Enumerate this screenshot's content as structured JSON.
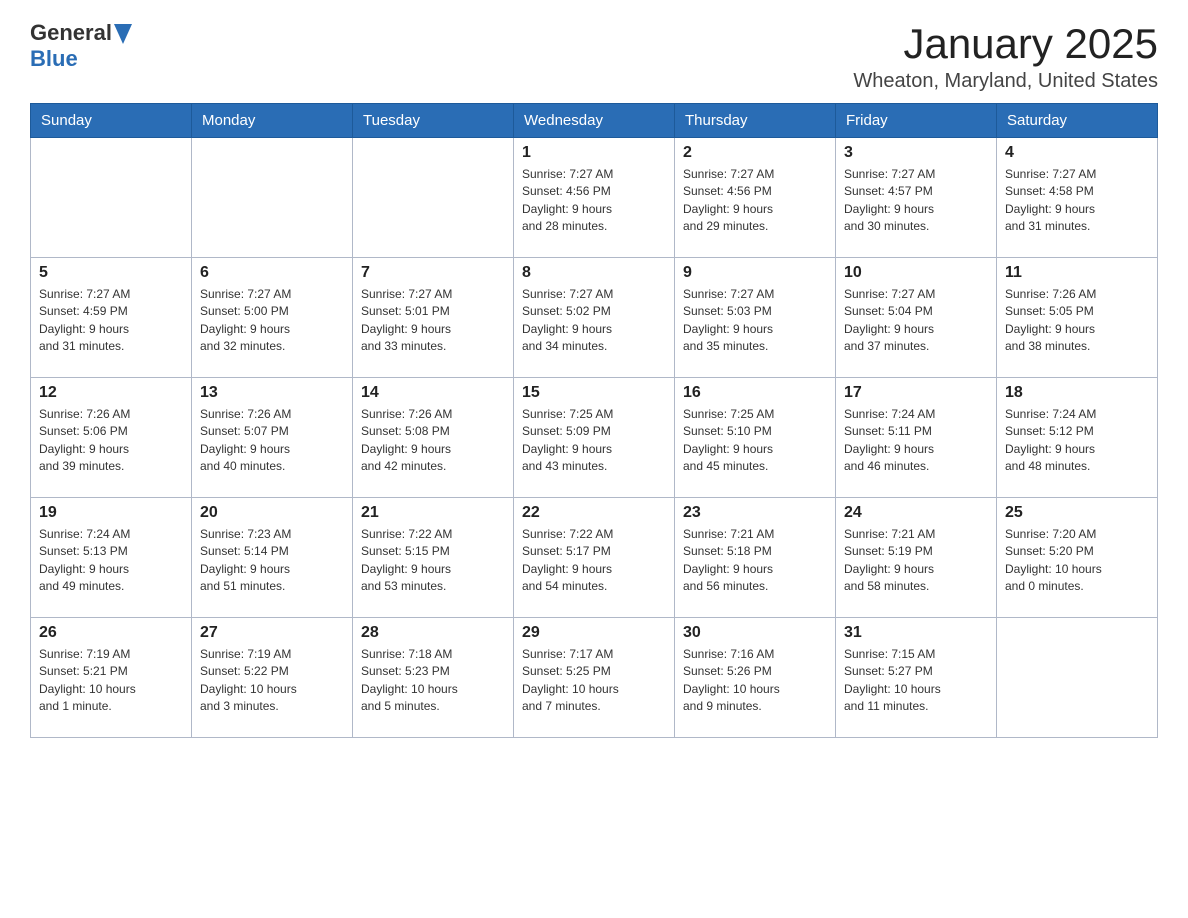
{
  "header": {
    "logo_general": "General",
    "logo_blue": "Blue",
    "month": "January 2025",
    "location": "Wheaton, Maryland, United States"
  },
  "weekdays": [
    "Sunday",
    "Monday",
    "Tuesday",
    "Wednesday",
    "Thursday",
    "Friday",
    "Saturday"
  ],
  "weeks": [
    [
      {
        "day": "",
        "info": ""
      },
      {
        "day": "",
        "info": ""
      },
      {
        "day": "",
        "info": ""
      },
      {
        "day": "1",
        "info": "Sunrise: 7:27 AM\nSunset: 4:56 PM\nDaylight: 9 hours\nand 28 minutes."
      },
      {
        "day": "2",
        "info": "Sunrise: 7:27 AM\nSunset: 4:56 PM\nDaylight: 9 hours\nand 29 minutes."
      },
      {
        "day": "3",
        "info": "Sunrise: 7:27 AM\nSunset: 4:57 PM\nDaylight: 9 hours\nand 30 minutes."
      },
      {
        "day": "4",
        "info": "Sunrise: 7:27 AM\nSunset: 4:58 PM\nDaylight: 9 hours\nand 31 minutes."
      }
    ],
    [
      {
        "day": "5",
        "info": "Sunrise: 7:27 AM\nSunset: 4:59 PM\nDaylight: 9 hours\nand 31 minutes."
      },
      {
        "day": "6",
        "info": "Sunrise: 7:27 AM\nSunset: 5:00 PM\nDaylight: 9 hours\nand 32 minutes."
      },
      {
        "day": "7",
        "info": "Sunrise: 7:27 AM\nSunset: 5:01 PM\nDaylight: 9 hours\nand 33 minutes."
      },
      {
        "day": "8",
        "info": "Sunrise: 7:27 AM\nSunset: 5:02 PM\nDaylight: 9 hours\nand 34 minutes."
      },
      {
        "day": "9",
        "info": "Sunrise: 7:27 AM\nSunset: 5:03 PM\nDaylight: 9 hours\nand 35 minutes."
      },
      {
        "day": "10",
        "info": "Sunrise: 7:27 AM\nSunset: 5:04 PM\nDaylight: 9 hours\nand 37 minutes."
      },
      {
        "day": "11",
        "info": "Sunrise: 7:26 AM\nSunset: 5:05 PM\nDaylight: 9 hours\nand 38 minutes."
      }
    ],
    [
      {
        "day": "12",
        "info": "Sunrise: 7:26 AM\nSunset: 5:06 PM\nDaylight: 9 hours\nand 39 minutes."
      },
      {
        "day": "13",
        "info": "Sunrise: 7:26 AM\nSunset: 5:07 PM\nDaylight: 9 hours\nand 40 minutes."
      },
      {
        "day": "14",
        "info": "Sunrise: 7:26 AM\nSunset: 5:08 PM\nDaylight: 9 hours\nand 42 minutes."
      },
      {
        "day": "15",
        "info": "Sunrise: 7:25 AM\nSunset: 5:09 PM\nDaylight: 9 hours\nand 43 minutes."
      },
      {
        "day": "16",
        "info": "Sunrise: 7:25 AM\nSunset: 5:10 PM\nDaylight: 9 hours\nand 45 minutes."
      },
      {
        "day": "17",
        "info": "Sunrise: 7:24 AM\nSunset: 5:11 PM\nDaylight: 9 hours\nand 46 minutes."
      },
      {
        "day": "18",
        "info": "Sunrise: 7:24 AM\nSunset: 5:12 PM\nDaylight: 9 hours\nand 48 minutes."
      }
    ],
    [
      {
        "day": "19",
        "info": "Sunrise: 7:24 AM\nSunset: 5:13 PM\nDaylight: 9 hours\nand 49 minutes."
      },
      {
        "day": "20",
        "info": "Sunrise: 7:23 AM\nSunset: 5:14 PM\nDaylight: 9 hours\nand 51 minutes."
      },
      {
        "day": "21",
        "info": "Sunrise: 7:22 AM\nSunset: 5:15 PM\nDaylight: 9 hours\nand 53 minutes."
      },
      {
        "day": "22",
        "info": "Sunrise: 7:22 AM\nSunset: 5:17 PM\nDaylight: 9 hours\nand 54 minutes."
      },
      {
        "day": "23",
        "info": "Sunrise: 7:21 AM\nSunset: 5:18 PM\nDaylight: 9 hours\nand 56 minutes."
      },
      {
        "day": "24",
        "info": "Sunrise: 7:21 AM\nSunset: 5:19 PM\nDaylight: 9 hours\nand 58 minutes."
      },
      {
        "day": "25",
        "info": "Sunrise: 7:20 AM\nSunset: 5:20 PM\nDaylight: 10 hours\nand 0 minutes."
      }
    ],
    [
      {
        "day": "26",
        "info": "Sunrise: 7:19 AM\nSunset: 5:21 PM\nDaylight: 10 hours\nand 1 minute."
      },
      {
        "day": "27",
        "info": "Sunrise: 7:19 AM\nSunset: 5:22 PM\nDaylight: 10 hours\nand 3 minutes."
      },
      {
        "day": "28",
        "info": "Sunrise: 7:18 AM\nSunset: 5:23 PM\nDaylight: 10 hours\nand 5 minutes."
      },
      {
        "day": "29",
        "info": "Sunrise: 7:17 AM\nSunset: 5:25 PM\nDaylight: 10 hours\nand 7 minutes."
      },
      {
        "day": "30",
        "info": "Sunrise: 7:16 AM\nSunset: 5:26 PM\nDaylight: 10 hours\nand 9 minutes."
      },
      {
        "day": "31",
        "info": "Sunrise: 7:15 AM\nSunset: 5:27 PM\nDaylight: 10 hours\nand 11 minutes."
      },
      {
        "day": "",
        "info": ""
      }
    ]
  ]
}
